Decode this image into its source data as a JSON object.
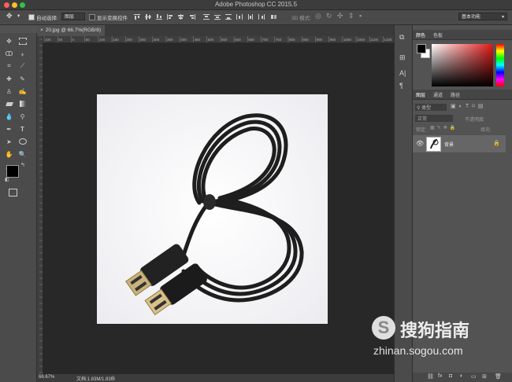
{
  "window": {
    "title": "Adobe Photoshop CC 2015.5"
  },
  "options": {
    "auto_select_label": "自动选择:",
    "auto_select_value": "图层",
    "transform_label": "显示变换控件",
    "mode_3d": "3D 模式:",
    "workspace": "基本功能"
  },
  "document": {
    "tab_title": "20.jpg @ 66.7%(RGB/8)"
  },
  "rulers": {
    "h_ticks": [
      "100",
      "50",
      "0",
      "50",
      "100",
      "150",
      "200",
      "250",
      "300",
      "350",
      "400",
      "450",
      "500",
      "550",
      "600",
      "650",
      "700",
      "750",
      "800",
      "850",
      "900",
      "950",
      "1000",
      "1050",
      "1100",
      "1150",
      "1200"
    ]
  },
  "status": {
    "zoom": "66.67%",
    "doc": "文档:1.83M/1.83M"
  },
  "panels": {
    "color_tabs": [
      "颜色",
      "色板"
    ],
    "layer_tabs": [
      "图层",
      "通道",
      "路径"
    ],
    "kind_label": "类型",
    "blend_mode": "正常",
    "opacity_label": "不透明度:",
    "lock_label": "锁定:",
    "fill_label": "填充:",
    "layer_name": "背景"
  },
  "watermark": {
    "brand": "搜狗指南",
    "url": "zhinan.sogou.com"
  },
  "colors": {
    "accent": "#ff5f57",
    "panel": "#535353",
    "canvas": "#282828"
  },
  "icons": [
    "move-icon",
    "marquee-icon",
    "lasso-icon",
    "magic-wand-icon",
    "crop-icon",
    "eyedropper-icon",
    "healing-icon",
    "brush-icon",
    "stamp-icon",
    "history-brush-icon",
    "eraser-icon",
    "gradient-icon",
    "blur-icon",
    "dodge-icon",
    "pen-icon",
    "type-icon",
    "path-select-icon",
    "shape-icon",
    "hand-icon",
    "zoom-icon",
    "more-icon",
    "eye-icon",
    "lock-icon"
  ]
}
